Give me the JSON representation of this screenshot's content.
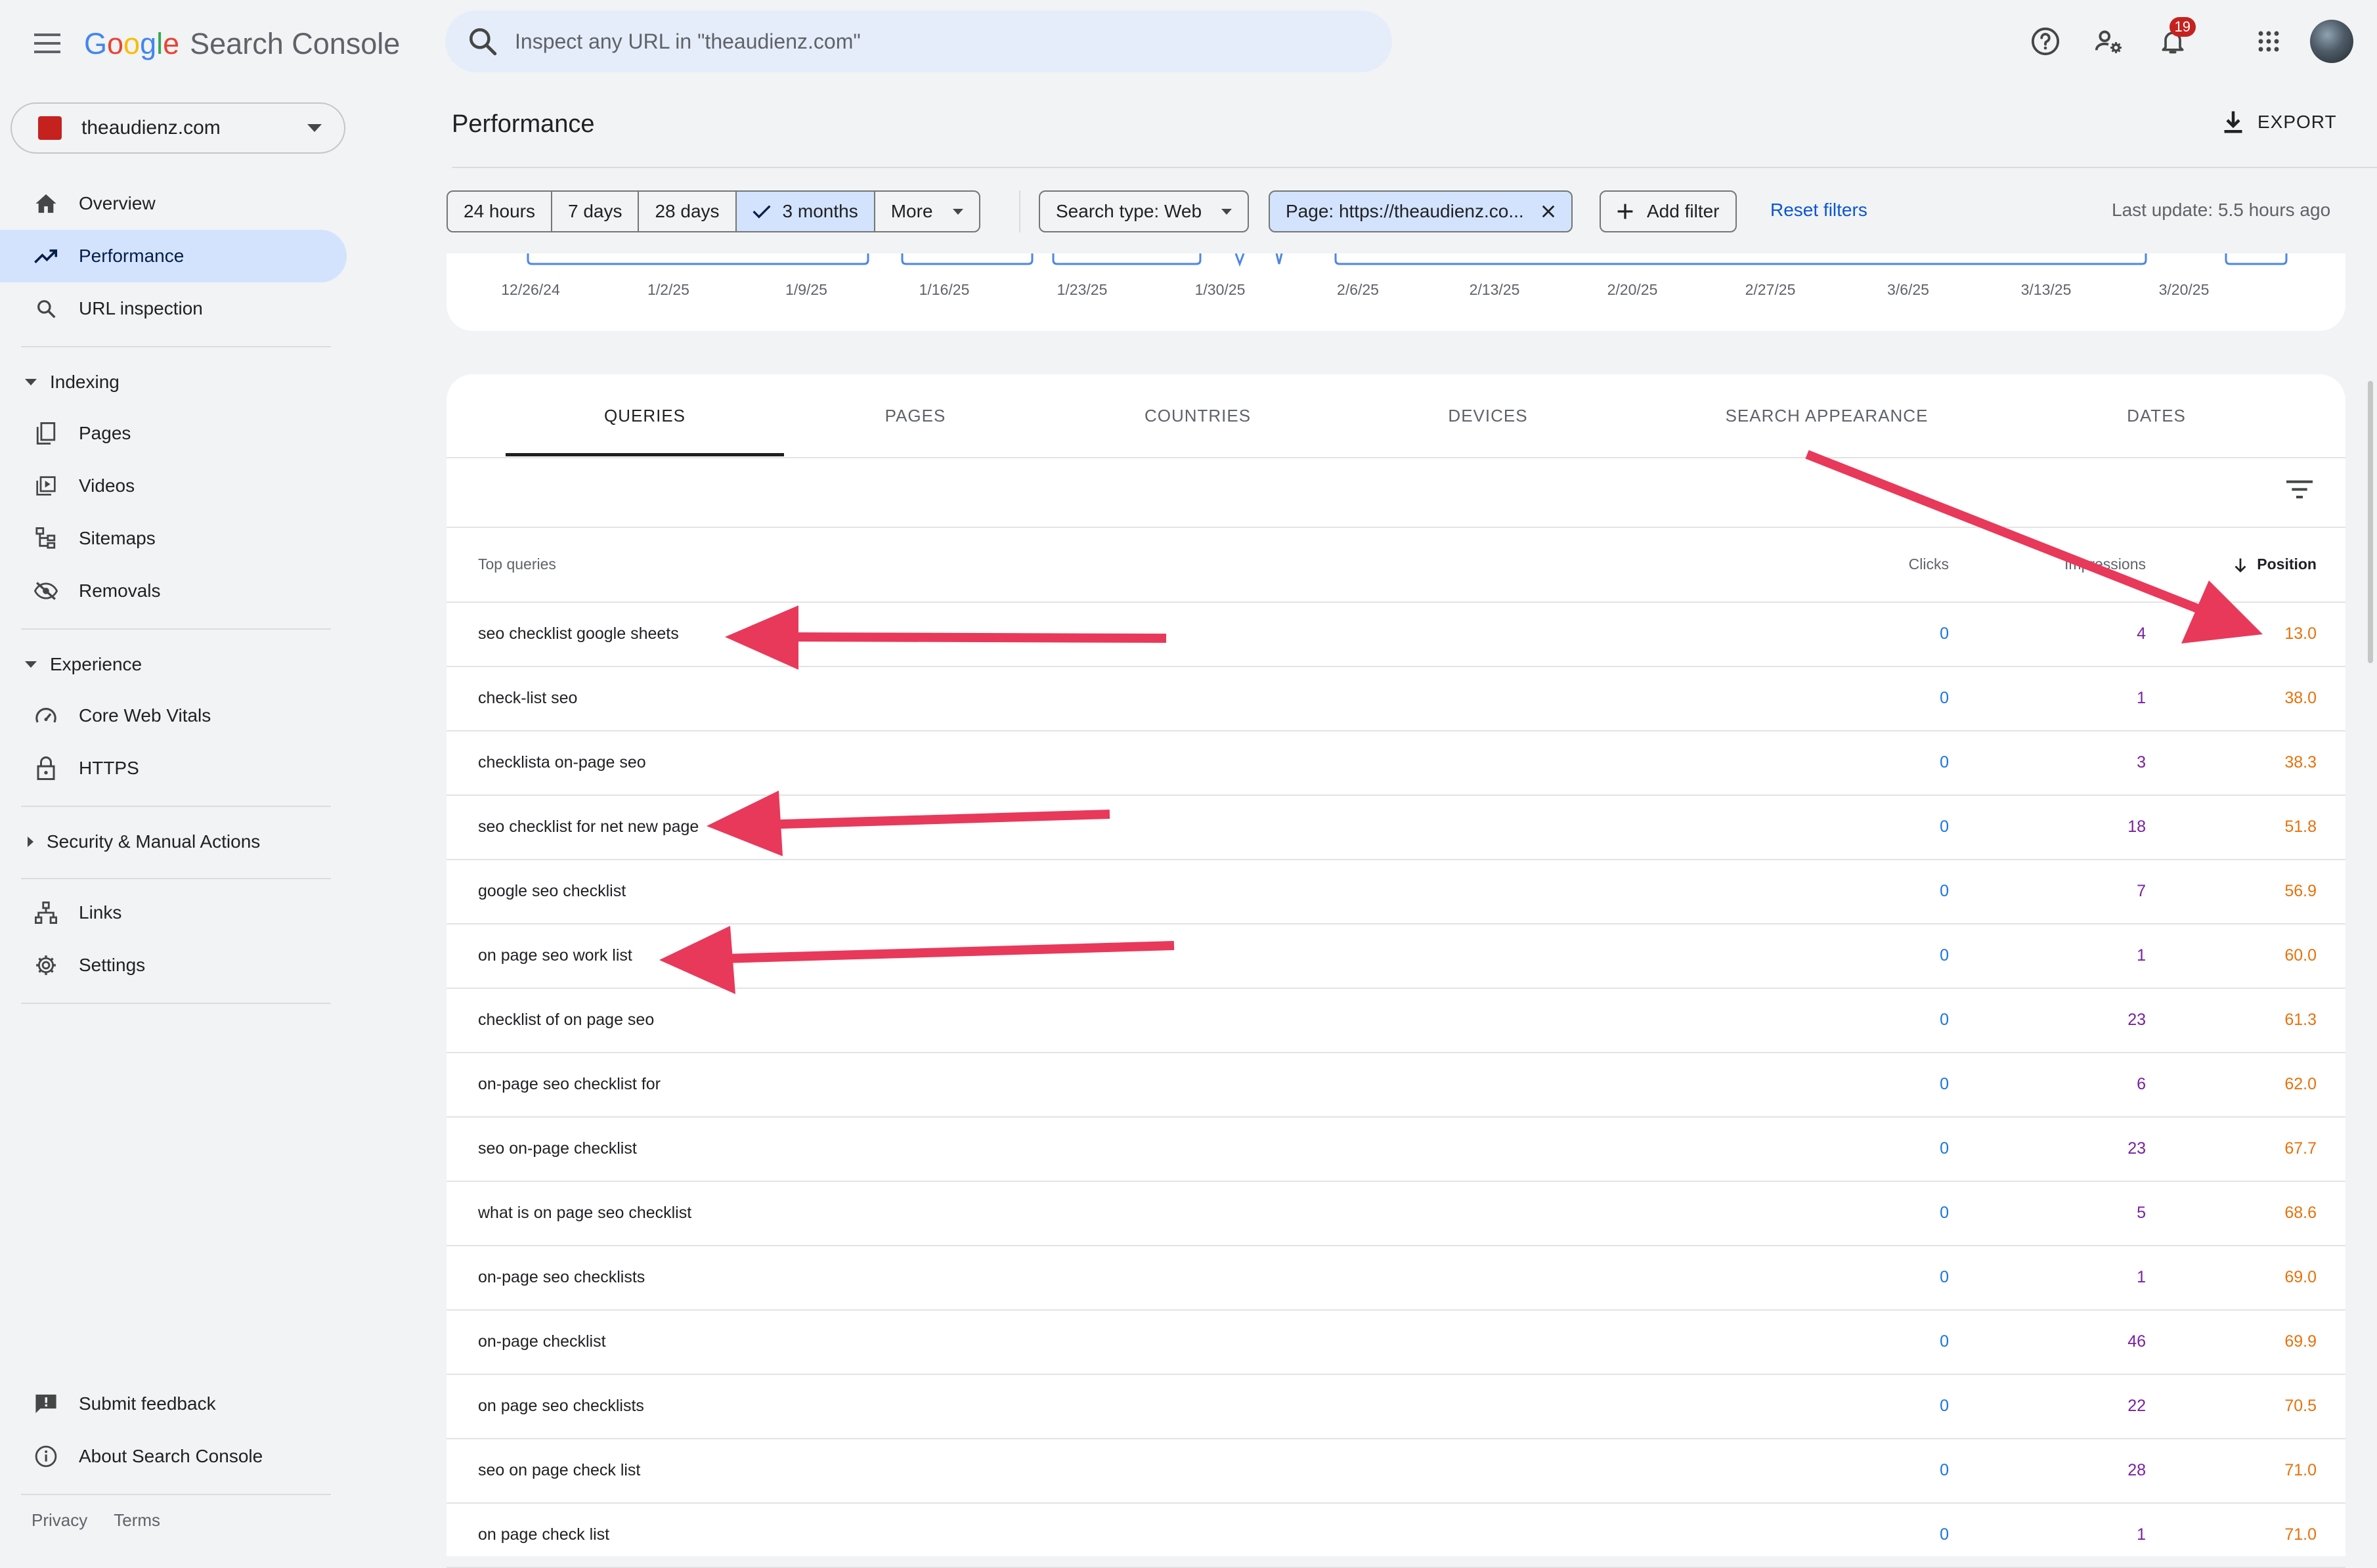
{
  "app": {
    "logo_word": "Google",
    "product": "Search Console"
  },
  "search": {
    "placeholder": "Inspect any URL in \"theaudienz.com\""
  },
  "top": {
    "notifications": "19"
  },
  "property": {
    "name": "theaudienz.com"
  },
  "sidebar": {
    "overview": "Overview",
    "performance": "Performance",
    "url_inspection": "URL inspection",
    "indexing": "Indexing",
    "pages": "Pages",
    "videos": "Videos",
    "sitemaps": "Sitemaps",
    "removals": "Removals",
    "experience": "Experience",
    "core_web_vitals": "Core Web Vitals",
    "https": "HTTPS",
    "security": "Security & Manual Actions",
    "links": "Links",
    "settings": "Settings",
    "submit_feedback": "Submit feedback",
    "about": "About Search Console",
    "privacy": "Privacy",
    "terms": "Terms"
  },
  "header": {
    "title": "Performance",
    "export": "EXPORT"
  },
  "filters": {
    "ranges": [
      "24 hours",
      "7 days",
      "28 days",
      "3 months",
      "More"
    ],
    "selected_range": "3 months",
    "search_type": "Search type: Web",
    "page": "Page: https://theaudienz.co...",
    "add_filter": "Add filter",
    "reset": "Reset filters",
    "last_update": "Last update: 5.5 hours ago"
  },
  "chart_axis": [
    "12/26/24",
    "1/2/25",
    "1/9/25",
    "1/16/25",
    "1/23/25",
    "1/30/25",
    "2/6/25",
    "2/13/25",
    "2/20/25",
    "2/27/25",
    "3/6/25",
    "3/13/25",
    "3/20/25"
  ],
  "tabs": [
    "QUERIES",
    "PAGES",
    "COUNTRIES",
    "DEVICES",
    "SEARCH APPEARANCE",
    "DATES"
  ],
  "table": {
    "headers": {
      "query": "Top queries",
      "clicks": "Clicks",
      "impressions": "Impressions",
      "position": "Position"
    },
    "rows": [
      {
        "query": "seo checklist google sheets",
        "clicks": "0",
        "impressions": "4",
        "position": "13.0"
      },
      {
        "query": "check-list seo",
        "clicks": "0",
        "impressions": "1",
        "position": "38.0"
      },
      {
        "query": "checklista on-page seo",
        "clicks": "0",
        "impressions": "3",
        "position": "38.3"
      },
      {
        "query": "seo checklist for net new page",
        "clicks": "0",
        "impressions": "18",
        "position": "51.8"
      },
      {
        "query": "google seo checklist",
        "clicks": "0",
        "impressions": "7",
        "position": "56.9"
      },
      {
        "query": "on page seo work list",
        "clicks": "0",
        "impressions": "1",
        "position": "60.0"
      },
      {
        "query": "checklist of on page seo",
        "clicks": "0",
        "impressions": "23",
        "position": "61.3"
      },
      {
        "query": "on-page seo checklist for",
        "clicks": "0",
        "impressions": "6",
        "position": "62.0"
      },
      {
        "query": "seo on-page checklist",
        "clicks": "0",
        "impressions": "23",
        "position": "67.7"
      },
      {
        "query": "what is on page seo checklist",
        "clicks": "0",
        "impressions": "5",
        "position": "68.6"
      },
      {
        "query": "on-page seo checklists",
        "clicks": "0",
        "impressions": "1",
        "position": "69.0"
      },
      {
        "query": "on-page checklist",
        "clicks": "0",
        "impressions": "46",
        "position": "69.9"
      },
      {
        "query": "on page seo checklists",
        "clicks": "0",
        "impressions": "22",
        "position": "70.5"
      },
      {
        "query": "seo on page check list",
        "clicks": "0",
        "impressions": "28",
        "position": "71.0"
      },
      {
        "query": "on page check list",
        "clicks": "0",
        "impressions": "1",
        "position": "71.0"
      }
    ]
  },
  "colors": {
    "accent": "#1a73e8",
    "clicks": "#1a73e8",
    "impressions": "#7b1fa2",
    "position": "#e8710a",
    "annotation_arrow": "#e8395a"
  }
}
